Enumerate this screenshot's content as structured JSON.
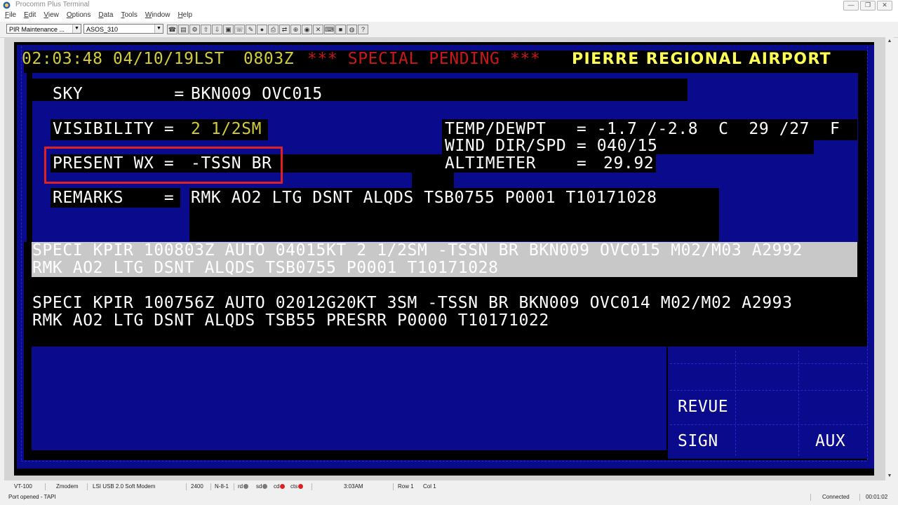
{
  "window": {
    "title": "Procomm Plus Terminal",
    "controls": [
      "—",
      "❐",
      "✕"
    ]
  },
  "menu": [
    {
      "label": "File",
      "key": "F"
    },
    {
      "label": "Edit",
      "key": "E"
    },
    {
      "label": "View",
      "key": "V"
    },
    {
      "label": "Options",
      "key": "O"
    },
    {
      "label": "Data",
      "key": "D"
    },
    {
      "label": "Tools",
      "key": "T"
    },
    {
      "label": "Window",
      "key": "W"
    },
    {
      "label": "Help",
      "key": "H"
    }
  ],
  "toolbar": {
    "profile_combo": "PIR Maintenance ...",
    "session_combo": "ASOS_310",
    "help_button": "?"
  },
  "terminal": {
    "clock": "02:03:48 04/10/19LST",
    "zulu": "0803Z",
    "alert": "*** SPECIAL PENDING ***",
    "station": "PIERRE REGIONAL AIRPORT",
    "sky_label": "SKY         =",
    "sky_value": "BKN009 OVC015",
    "vis_label": "VISIBILITY =",
    "vis_value": "2 1/2SM",
    "wx_label": "PRESENT WX =",
    "wx_value": "-TSSN BR",
    "remarks_label": "REMARKS    =",
    "remarks_value": "RMK AO2 LTG DSNT ALQDS TSB0755 P0001 T10171028",
    "temp_line": "TEMP/DEWPT   = -1.7 /-2.8  C  29 /27  F",
    "wind_line": "WIND DIR/SPD = 040/15",
    "alt_label": "ALTIMETER    =",
    "alt_value": "29.92",
    "speci1_line1": "SPECI KPIR 100803Z AUTO 04015KT 2 1/2SM -TSSN BR BKN009 OVC015 M02/M03 A2992",
    "speci1_line2": "RMK AO2 LTG DSNT ALQDS TSB0755 P0001 T10171028",
    "speci2_line1": "SPECI KPIR 100756Z AUTO 02012G20KT 3SM -TSSN BR BKN009 OVC014 M02/M02 A2993",
    "speci2_line2": "RMK AO2 LTG DSNT ALQDS TSB55 PRESRR P0000 T10171022",
    "fkey_revue": "REVUE",
    "fkey_sign": "SIGN",
    "fkey_aux": "AUX"
  },
  "status": {
    "emulation": "VT-100",
    "protocol": "Zmodem",
    "modem": "LSI USB 2.0 Soft Modem",
    "baud": "2400",
    "parity": "N-8-1",
    "rd": "rd",
    "sd": "sd",
    "cd": "cd",
    "cts": "cts",
    "time": "3:03AM",
    "row": "Row 1",
    "col": "Col 1",
    "port": "Port opened - TAPI",
    "connection": "Connected",
    "elapsed": "00:01:02"
  },
  "colors": {
    "screen_blue": "#0a0a8c",
    "highlight_red": "#e02020",
    "amber": "#d2cc3c"
  }
}
